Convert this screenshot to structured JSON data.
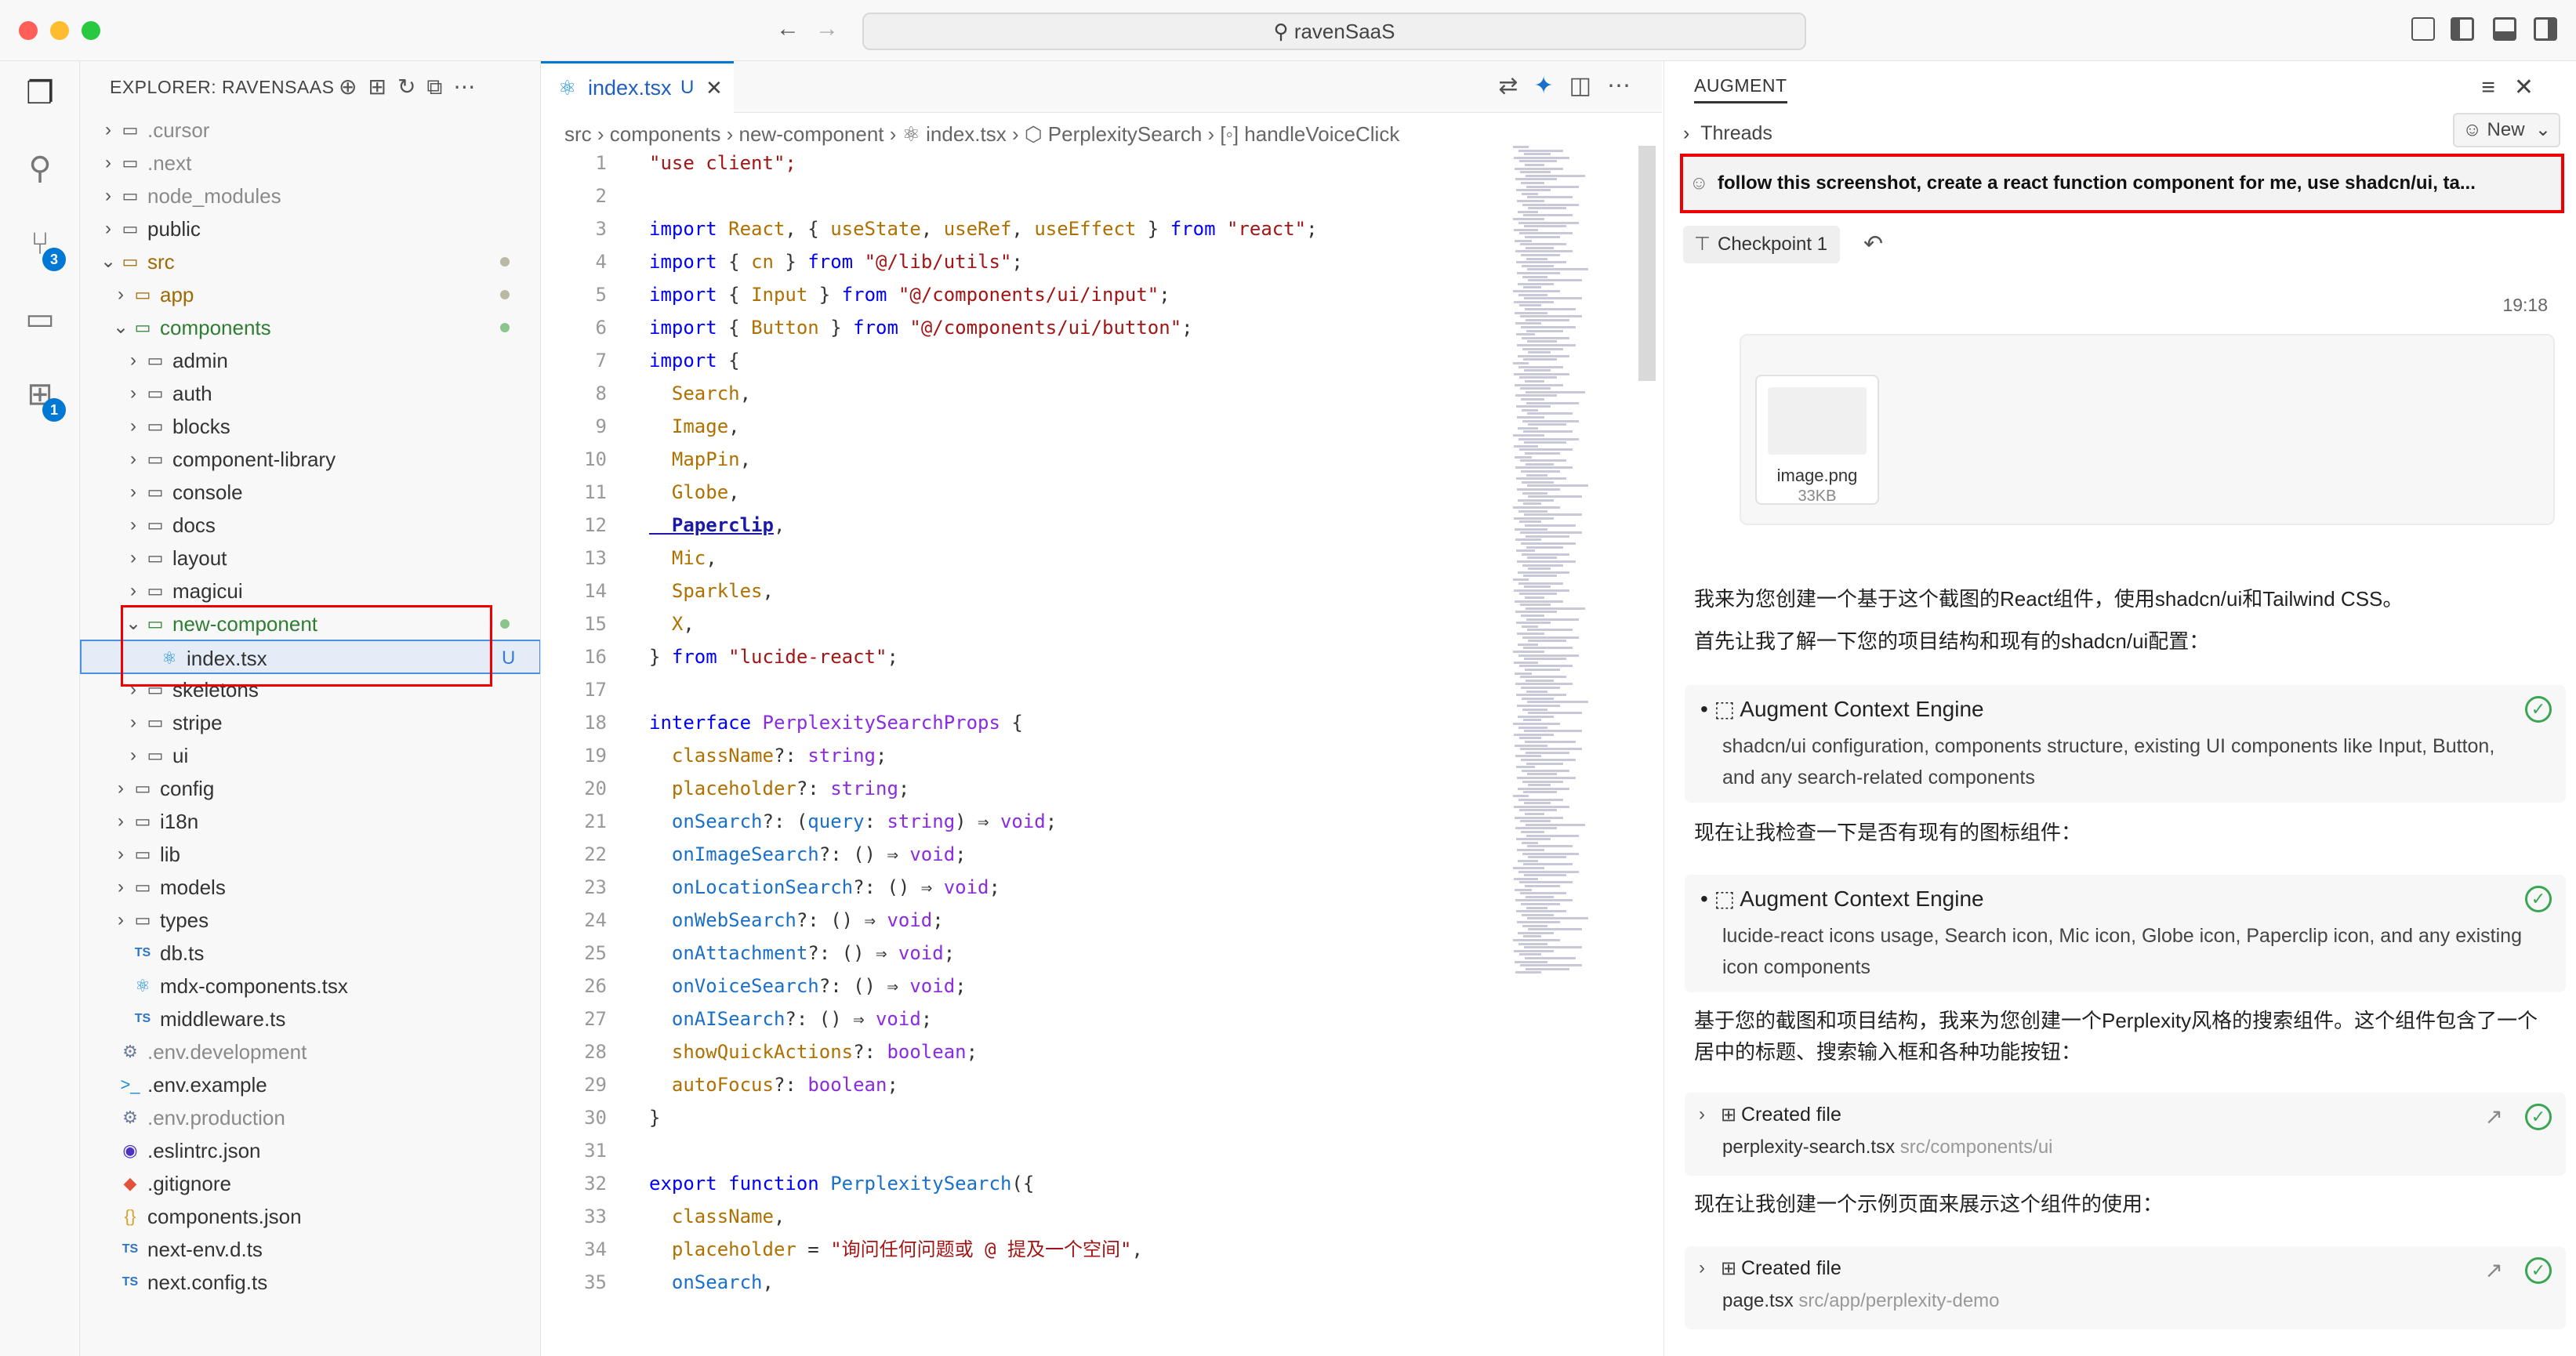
{
  "window": {
    "title": "ravenSaaS"
  },
  "activity": {
    "scm_badge": "3",
    "ext_badge": "1"
  },
  "explorer": {
    "header": "EXPLORER: RAVENSAAS",
    "items": [
      {
        "label": ".cursor",
        "kind": "folder",
        "depth": 0,
        "open": false,
        "style": "dim"
      },
      {
        "label": ".next",
        "kind": "folder",
        "depth": 0,
        "open": false,
        "style": "dim"
      },
      {
        "label": "node_modules",
        "kind": "folder",
        "depth": 0,
        "open": false,
        "style": "dim"
      },
      {
        "label": "public",
        "kind": "folder",
        "depth": 0,
        "open": false,
        "style": ""
      },
      {
        "label": "src",
        "kind": "folder",
        "depth": 0,
        "open": true,
        "style": "gold",
        "dot": "gray"
      },
      {
        "label": "app",
        "kind": "folder",
        "depth": 1,
        "open": false,
        "style": "gold",
        "dot": "gray"
      },
      {
        "label": "components",
        "kind": "folder",
        "depth": 1,
        "open": true,
        "style": "green",
        "dot": "green"
      },
      {
        "label": "admin",
        "kind": "folder",
        "depth": 2,
        "open": false,
        "style": ""
      },
      {
        "label": "auth",
        "kind": "folder",
        "depth": 2,
        "open": false,
        "style": ""
      },
      {
        "label": "blocks",
        "kind": "folder",
        "depth": 2,
        "open": false,
        "style": ""
      },
      {
        "label": "component-library",
        "kind": "folder",
        "depth": 2,
        "open": false,
        "style": ""
      },
      {
        "label": "console",
        "kind": "folder",
        "depth": 2,
        "open": false,
        "style": ""
      },
      {
        "label": "docs",
        "kind": "folder",
        "depth": 2,
        "open": false,
        "style": ""
      },
      {
        "label": "layout",
        "kind": "folder",
        "depth": 2,
        "open": false,
        "style": ""
      },
      {
        "label": "magicui",
        "kind": "folder",
        "depth": 2,
        "open": false,
        "style": ""
      },
      {
        "label": "new-component",
        "kind": "folder",
        "depth": 2,
        "open": true,
        "style": "green",
        "dot": "green"
      },
      {
        "label": "index.tsx",
        "kind": "react",
        "depth": 3,
        "style": "",
        "selected": true,
        "badge": "U"
      },
      {
        "label": "skeletons",
        "kind": "folder",
        "depth": 2,
        "open": false,
        "style": ""
      },
      {
        "label": "stripe",
        "kind": "folder",
        "depth": 2,
        "open": false,
        "style": ""
      },
      {
        "label": "ui",
        "kind": "folder",
        "depth": 2,
        "open": false,
        "style": ""
      },
      {
        "label": "config",
        "kind": "folder",
        "depth": 1,
        "open": false,
        "style": ""
      },
      {
        "label": "i18n",
        "kind": "folder",
        "depth": 1,
        "open": false,
        "style": ""
      },
      {
        "label": "lib",
        "kind": "folder",
        "depth": 1,
        "open": false,
        "style": ""
      },
      {
        "label": "models",
        "kind": "folder",
        "depth": 1,
        "open": false,
        "style": ""
      },
      {
        "label": "types",
        "kind": "folder",
        "depth": 1,
        "open": false,
        "style": ""
      },
      {
        "label": "db.ts",
        "kind": "ts",
        "depth": 1,
        "style": ""
      },
      {
        "label": "mdx-components.tsx",
        "kind": "react",
        "depth": 1,
        "style": ""
      },
      {
        "label": "middleware.ts",
        "kind": "ts",
        "depth": 1,
        "style": ""
      },
      {
        "label": ".env.development",
        "kind": "gear",
        "depth": 0,
        "style": "dim"
      },
      {
        "label": ".env.example",
        "kind": "term",
        "depth": 0,
        "style": ""
      },
      {
        "label": ".env.production",
        "kind": "gear",
        "depth": 0,
        "style": "dim"
      },
      {
        "label": ".eslintrc.json",
        "kind": "eslint",
        "depth": 0,
        "style": ""
      },
      {
        "label": ".gitignore",
        "kind": "git",
        "depth": 0,
        "style": ""
      },
      {
        "label": "components.json",
        "kind": "json",
        "depth": 0,
        "style": ""
      },
      {
        "label": "next-env.d.ts",
        "kind": "ts",
        "depth": 0,
        "style": ""
      },
      {
        "label": "next.config.ts",
        "kind": "ts",
        "depth": 0,
        "style": ""
      }
    ]
  },
  "editor": {
    "tab": {
      "label": "index.tsx",
      "badge": "U"
    },
    "breadcrumb": "src  ›  components  ›  new-component  ›  ⚛ index.tsx  ›  ⬡ PerplexitySearch  ›  [◦] handleVoiceClick",
    "lines": [
      {
        "n": "1",
        "t": [
          [
            "\"use client\";",
            "#a31515"
          ]
        ]
      },
      {
        "n": "2",
        "t": []
      },
      {
        "n": "3",
        "t": [
          [
            "import ",
            "#0000ff"
          ],
          [
            "React",
            "#b07000"
          ],
          [
            ", { ",
            "#333"
          ],
          [
            "useState",
            "#b07000"
          ],
          [
            ", ",
            "#333"
          ],
          [
            "useRef",
            "#b07000"
          ],
          [
            ", ",
            "#333"
          ],
          [
            "useEffect",
            "#b07000"
          ],
          [
            " } ",
            "#333"
          ],
          [
            "from ",
            "#0000ff"
          ],
          [
            "\"react\"",
            "#a31515"
          ],
          [
            ";",
            "#333"
          ]
        ]
      },
      {
        "n": "4",
        "t": [
          [
            "import ",
            "#0000ff"
          ],
          [
            "{ ",
            "#333"
          ],
          [
            "cn",
            "#b07000"
          ],
          [
            " } ",
            "#333"
          ],
          [
            "from ",
            "#0000ff"
          ],
          [
            "\"@/lib/utils\"",
            "#a31515"
          ],
          [
            ";",
            "#333"
          ]
        ]
      },
      {
        "n": "5",
        "t": [
          [
            "import ",
            "#0000ff"
          ],
          [
            "{ ",
            "#333"
          ],
          [
            "Input",
            "#b07000"
          ],
          [
            " } ",
            "#333"
          ],
          [
            "from ",
            "#0000ff"
          ],
          [
            "\"@/components/ui/input\"",
            "#a31515"
          ],
          [
            ";",
            "#333"
          ]
        ]
      },
      {
        "n": "6",
        "t": [
          [
            "import ",
            "#0000ff"
          ],
          [
            "{ ",
            "#333"
          ],
          [
            "Button",
            "#b07000"
          ],
          [
            " } ",
            "#333"
          ],
          [
            "from ",
            "#0000ff"
          ],
          [
            "\"@/components/ui/button\"",
            "#a31515"
          ],
          [
            ";",
            "#333"
          ]
        ]
      },
      {
        "n": "7",
        "t": [
          [
            "import ",
            "#0000ff"
          ],
          [
            "{",
            "#333"
          ]
        ]
      },
      {
        "n": "8",
        "t": [
          [
            "  Search",
            "#b07000"
          ],
          [
            ",",
            "#333"
          ]
        ]
      },
      {
        "n": "9",
        "t": [
          [
            "  Image",
            "#b07000"
          ],
          [
            ",",
            "#333"
          ]
        ]
      },
      {
        "n": "10",
        "t": [
          [
            "  MapPin",
            "#b07000"
          ],
          [
            ",",
            "#333"
          ]
        ]
      },
      {
        "n": "11",
        "t": [
          [
            "  Globe",
            "#b07000"
          ],
          [
            ",",
            "#333"
          ]
        ]
      },
      {
        "n": "12",
        "t": [
          [
            "  Paperclip",
            "#1a1aa6"
          ],
          [
            ",",
            "#333"
          ]
        ]
      },
      {
        "n": "13",
        "t": [
          [
            "  Mic",
            "#b07000"
          ],
          [
            ",",
            "#333"
          ]
        ]
      },
      {
        "n": "14",
        "t": [
          [
            "  Sparkles",
            "#b07000"
          ],
          [
            ",",
            "#333"
          ]
        ]
      },
      {
        "n": "15",
        "t": [
          [
            "  X",
            "#b07000"
          ],
          [
            ",",
            "#333"
          ]
        ]
      },
      {
        "n": "16",
        "t": [
          [
            "} ",
            "#333"
          ],
          [
            "from ",
            "#0000ff"
          ],
          [
            "\"lucide-react\"",
            "#a31515"
          ],
          [
            ";",
            "#333"
          ]
        ]
      },
      {
        "n": "17",
        "t": []
      },
      {
        "n": "18",
        "t": [
          [
            "interface ",
            "#0000ff"
          ],
          [
            "PerplexitySearchProps",
            "#8a2be2"
          ],
          [
            " {",
            "#333"
          ]
        ]
      },
      {
        "n": "19",
        "t": [
          [
            "  className",
            "#b07000"
          ],
          [
            "?: ",
            "#333"
          ],
          [
            "string",
            "#8a2be2"
          ],
          [
            ";",
            "#333"
          ]
        ]
      },
      {
        "n": "20",
        "t": [
          [
            "  placeholder",
            "#b07000"
          ],
          [
            "?: ",
            "#333"
          ],
          [
            "string",
            "#8a2be2"
          ],
          [
            ";",
            "#333"
          ]
        ]
      },
      {
        "n": "21",
        "t": [
          [
            "  onSearch",
            "#1a70c8"
          ],
          [
            "?: (",
            "#333"
          ],
          [
            "query",
            "#1a70c8"
          ],
          [
            ": ",
            "#333"
          ],
          [
            "string",
            "#8a2be2"
          ],
          [
            ") ⇒ ",
            "#333"
          ],
          [
            "void",
            "#8a2be2"
          ],
          [
            ";",
            "#333"
          ]
        ]
      },
      {
        "n": "22",
        "t": [
          [
            "  onImageSearch",
            "#1a70c8"
          ],
          [
            "?: () ⇒ ",
            "#333"
          ],
          [
            "void",
            "#8a2be2"
          ],
          [
            ";",
            "#333"
          ]
        ]
      },
      {
        "n": "23",
        "t": [
          [
            "  onLocationSearch",
            "#1a70c8"
          ],
          [
            "?: () ⇒ ",
            "#333"
          ],
          [
            "void",
            "#8a2be2"
          ],
          [
            ";",
            "#333"
          ]
        ]
      },
      {
        "n": "24",
        "t": [
          [
            "  onWebSearch",
            "#1a70c8"
          ],
          [
            "?: () ⇒ ",
            "#333"
          ],
          [
            "void",
            "#8a2be2"
          ],
          [
            ";",
            "#333"
          ]
        ]
      },
      {
        "n": "25",
        "t": [
          [
            "  onAttachment",
            "#1a70c8"
          ],
          [
            "?: () ⇒ ",
            "#333"
          ],
          [
            "void",
            "#8a2be2"
          ],
          [
            ";",
            "#333"
          ]
        ]
      },
      {
        "n": "26",
        "t": [
          [
            "  onVoiceSearch",
            "#1a70c8"
          ],
          [
            "?: () ⇒ ",
            "#333"
          ],
          [
            "void",
            "#8a2be2"
          ],
          [
            ";",
            "#333"
          ]
        ]
      },
      {
        "n": "27",
        "t": [
          [
            "  onAISearch",
            "#1a70c8"
          ],
          [
            "?: () ⇒ ",
            "#333"
          ],
          [
            "void",
            "#8a2be2"
          ],
          [
            ";",
            "#333"
          ]
        ]
      },
      {
        "n": "28",
        "t": [
          [
            "  showQuickActions",
            "#b07000"
          ],
          [
            "?: ",
            "#333"
          ],
          [
            "boolean",
            "#8a2be2"
          ],
          [
            ";",
            "#333"
          ]
        ]
      },
      {
        "n": "29",
        "t": [
          [
            "  autoFocus",
            "#b07000"
          ],
          [
            "?: ",
            "#333"
          ],
          [
            "boolean",
            "#8a2be2"
          ],
          [
            ";",
            "#333"
          ]
        ]
      },
      {
        "n": "30",
        "t": [
          [
            "}",
            "#333"
          ]
        ]
      },
      {
        "n": "31",
        "t": []
      },
      {
        "n": "32",
        "t": [
          [
            "export ",
            "#0000ff"
          ],
          [
            "function ",
            "#0000ff"
          ],
          [
            "PerplexitySearch",
            "#1a70c8"
          ],
          [
            "({",
            "#333"
          ]
        ]
      },
      {
        "n": "33",
        "t": [
          [
            "  className",
            "#b07000"
          ],
          [
            ",",
            "#333"
          ]
        ]
      },
      {
        "n": "34",
        "t": [
          [
            "  placeholder",
            "#b07000"
          ],
          [
            " = ",
            "#333"
          ],
          [
            "\"询问任何问题或 @ 提及一个空间\"",
            "#a31515"
          ],
          [
            ",",
            "#333"
          ]
        ]
      },
      {
        "n": "35",
        "t": [
          [
            "  onSearch",
            "#1a70c8"
          ],
          [
            ",",
            "#333"
          ]
        ]
      }
    ]
  },
  "augment": {
    "title": "AUGMENT",
    "threads": "Threads",
    "new_label": "New",
    "prompt": "follow this screenshot, create a react function component for me, use shadcn/ui, ta...",
    "checkpoint": "Checkpoint 1",
    "time": "19:18",
    "attachment": {
      "name": "image.png",
      "size": "33KB"
    },
    "msg1": "我来为您创建一个基于这个截图的React组件，使用shadcn/ui和Tailwind CSS。",
    "msg2": "首先让我了解一下您的项目结构和现有的shadcn/ui配置：",
    "tool1": {
      "title": "Augment Context Engine",
      "desc": "shadcn/ui configuration, components structure, existing UI components like Input, Button, and any search-related components"
    },
    "msg3": "现在让我检查一下是否有现有的图标组件：",
    "tool2": {
      "title": "Augment Context Engine",
      "desc": "lucide-react icons usage, Search icon, Mic icon, Globe icon, Paperclip icon, and any existing icon components"
    },
    "msg4a": "基于您的截图和项目结构，我来为您创建一个Perplexity风格的搜索组件。这个组件包含了一个",
    "msg4b": "居中的标题、搜索输入框和各种功能按钮：",
    "file1": {
      "label": "Created file",
      "name": "perplexity-search.tsx",
      "path": "src/components/ui"
    },
    "msg5": "现在让我创建一个示例页面来展示这个组件的使用：",
    "file2": {
      "label": "Created file",
      "name": "page.tsx",
      "path": "src/app/perplexity-demo"
    }
  }
}
